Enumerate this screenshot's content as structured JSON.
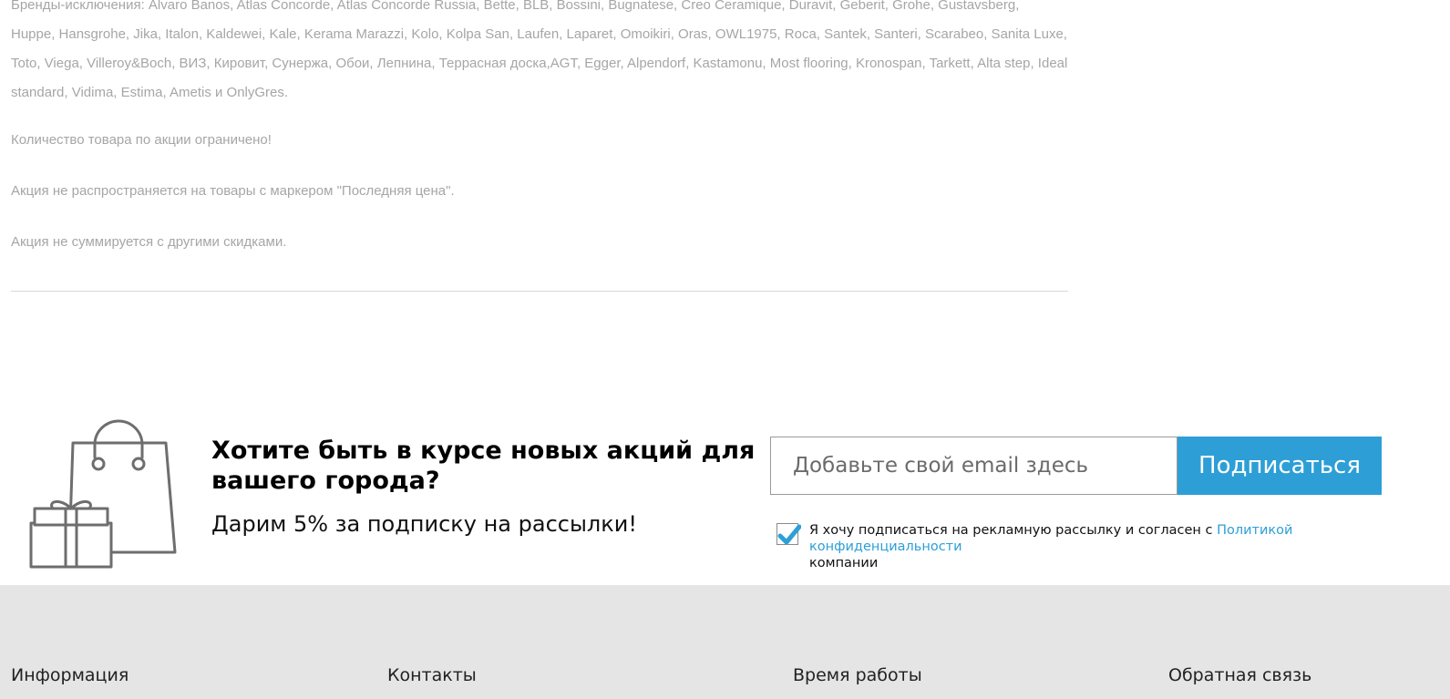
{
  "promo": {
    "brands_line1": "Бренды-исключения: Alvaro Banos, Atlas Concorde, Atlas Concorde Russia, Bette, BLB, Bossini, Bugnatese, Creo Ceramique, Duravit, Geberit, Grohe, Gustavsberg,",
    "brands_line2": "Huppe, Hansgrohe, Jika, Italon, Kaldewei, Kale, Kerama Marazzi, Kolo, Kolpa San, Laufen, Laparet, Omoikiri, Oras, OWL1975, Roca, Santek, Santeri, Scarabeo, Sanita Luxe,",
    "brands_line3": "Toto, Viega, Villeroy&Boch, ВИЗ, Кировит, Сунержа, Обои, Лепнина, Террасная доска,AGT, Egger, Alpendorf, Kastamonu, Most flooring, Kronospan, Tarkett, Alta step, Ideal",
    "brands_line4": "standard, Vidima, Estima, Ametis и OnlyGres.",
    "note_limited": "Количество товара по акции ограничено!",
    "note_last_price": "Акция не распространяется на товары с маркером \"Последняя цена\".",
    "note_no_sum": "Акция не суммируется с другими скидками."
  },
  "subscribe": {
    "title": "Хотите быть в курсе новых акций для вашего города?",
    "subtitle": "Дарим 5% за подписку на рассылки!",
    "email_placeholder": "Добавьте свой email здесь",
    "email_value": "",
    "button_label": "Подписаться",
    "consent_checked": true,
    "consent_text_before": "Я хочу подписаться на рекламную рассылку и согласен с ",
    "consent_link": "Политикой конфиденциальности",
    "consent_text_after": " компании",
    "icon": "shopping-bag-gift-icon",
    "accent_color": "#2d9fd6"
  },
  "footer": {
    "col1": "Информация",
    "col2": "Контакты",
    "col3": "Время работы",
    "col4": "Обратная связь",
    "background": "#e5e5e5"
  }
}
